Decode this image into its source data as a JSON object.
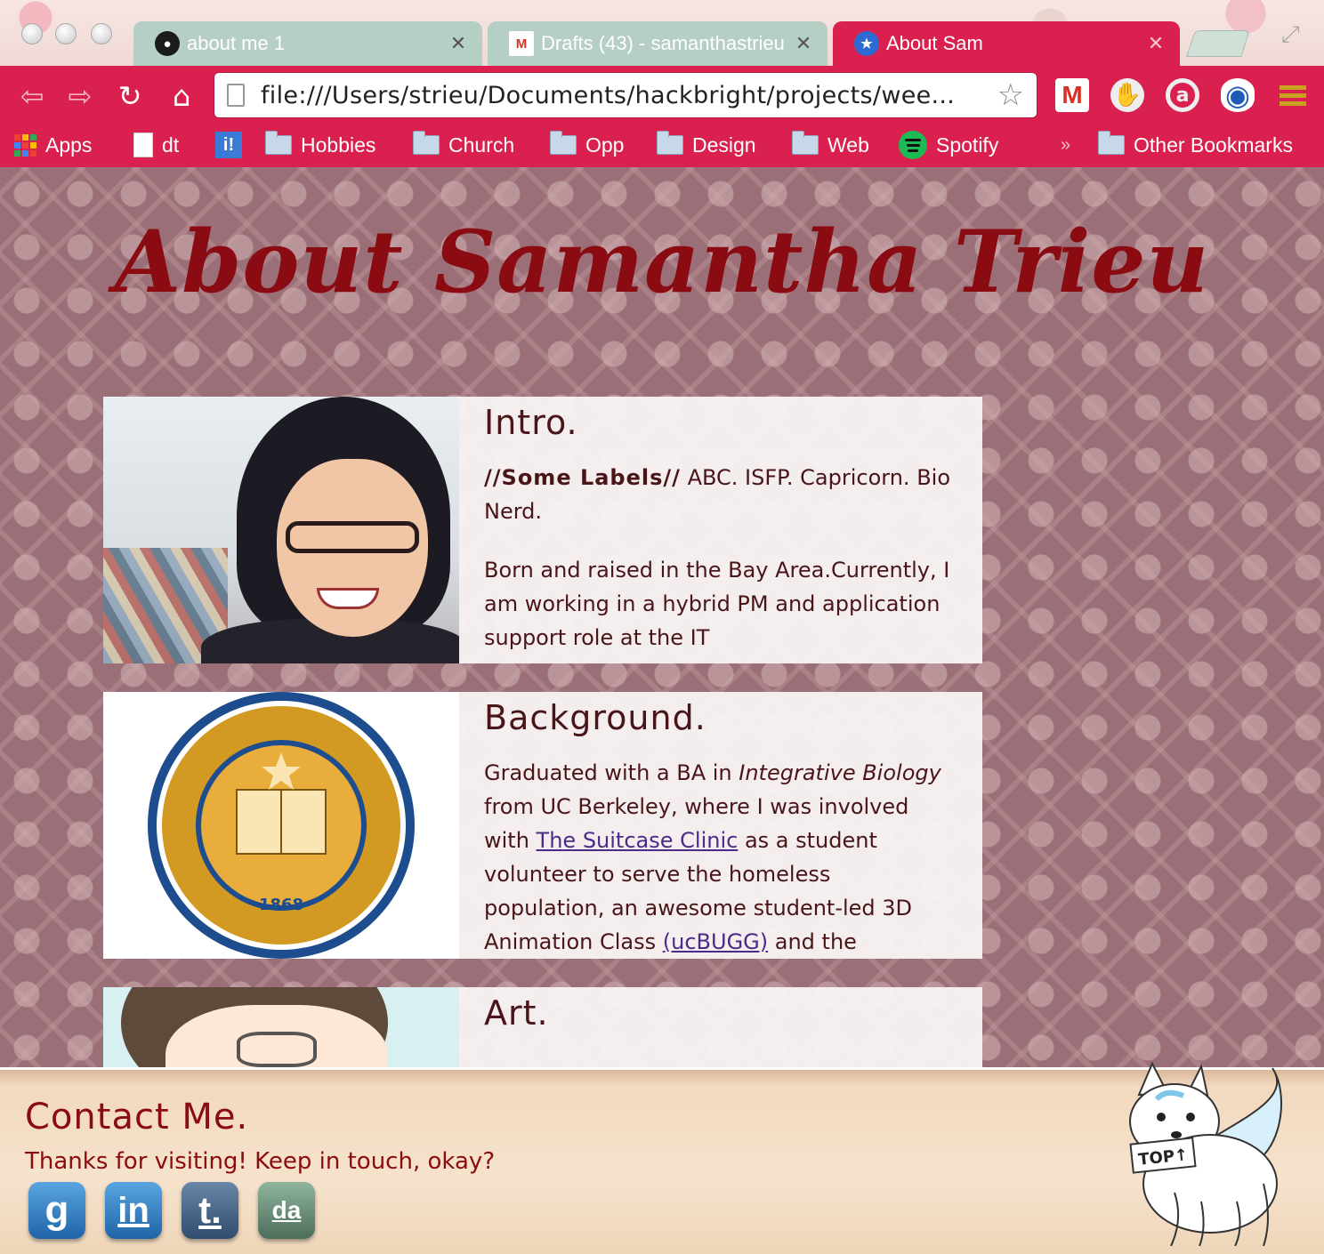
{
  "browser": {
    "tabs": [
      {
        "title": "about me 1",
        "favicon": "github-icon",
        "active": false
      },
      {
        "title": "Drafts (43) - samanthastrieu",
        "favicon": "gmail-icon",
        "active": false
      },
      {
        "title": "About Sam",
        "favicon": "star-badge-icon",
        "active": true
      }
    ],
    "url": "file:///Users/strieu/Documents/hackbright/projects/wee...",
    "bookmarks": [
      {
        "label": "Apps",
        "icon": "apps-grid-icon"
      },
      {
        "label": "dt",
        "icon": "page-icon"
      },
      {
        "label": "",
        "icon": "instapaper-icon"
      },
      {
        "label": "Hobbies",
        "icon": "folder-icon"
      },
      {
        "label": "Church",
        "icon": "folder-icon"
      },
      {
        "label": "Opp",
        "icon": "folder-icon"
      },
      {
        "label": "Design",
        "icon": "folder-icon"
      },
      {
        "label": "Web",
        "icon": "folder-icon"
      },
      {
        "label": "Spotify",
        "icon": "spotify-icon"
      }
    ],
    "overflow_chevron": "»",
    "other_bookmarks": "Other Bookmarks",
    "accent": "#d9204f"
  },
  "page": {
    "title": "About Samantha Trieu",
    "title_color": "#8b0b12",
    "intro": {
      "heading": "Intro.",
      "labels_prefix": "//Some Labels//",
      "labels_text": "ABC. ISFP. Capricorn. Bio Nerd.",
      "body": "Born and raised in the Bay Area.Currently, I am working in a hybrid PM and application support role at the IT"
    },
    "background": {
      "heading": "Background.",
      "text_1": "Graduated with a BA in ",
      "text_italic": "Integrative Biology",
      "text_2": " from UC Berkeley, where I was involved with ",
      "link_1": "The Suitcase Clinic",
      "text_3": " as a student volunteer to serve the homeless population, an awesome student-led 3D Animation Class ",
      "link_2": "(ucBUGG)",
      "text_4": " and the"
    },
    "art": {
      "heading": "Art."
    }
  },
  "footer": {
    "title": "Contact Me.",
    "subtitle": "Thanks for visiting! Keep in touch, okay?",
    "social": [
      {
        "glyph": "g",
        "icon": "google-icon"
      },
      {
        "glyph": "in",
        "icon": "linkedin-icon"
      },
      {
        "glyph": "t.",
        "icon": "tumblr-icon"
      },
      {
        "glyph": "da",
        "icon": "deviantart-icon"
      }
    ],
    "top_label": "TOP↑"
  }
}
